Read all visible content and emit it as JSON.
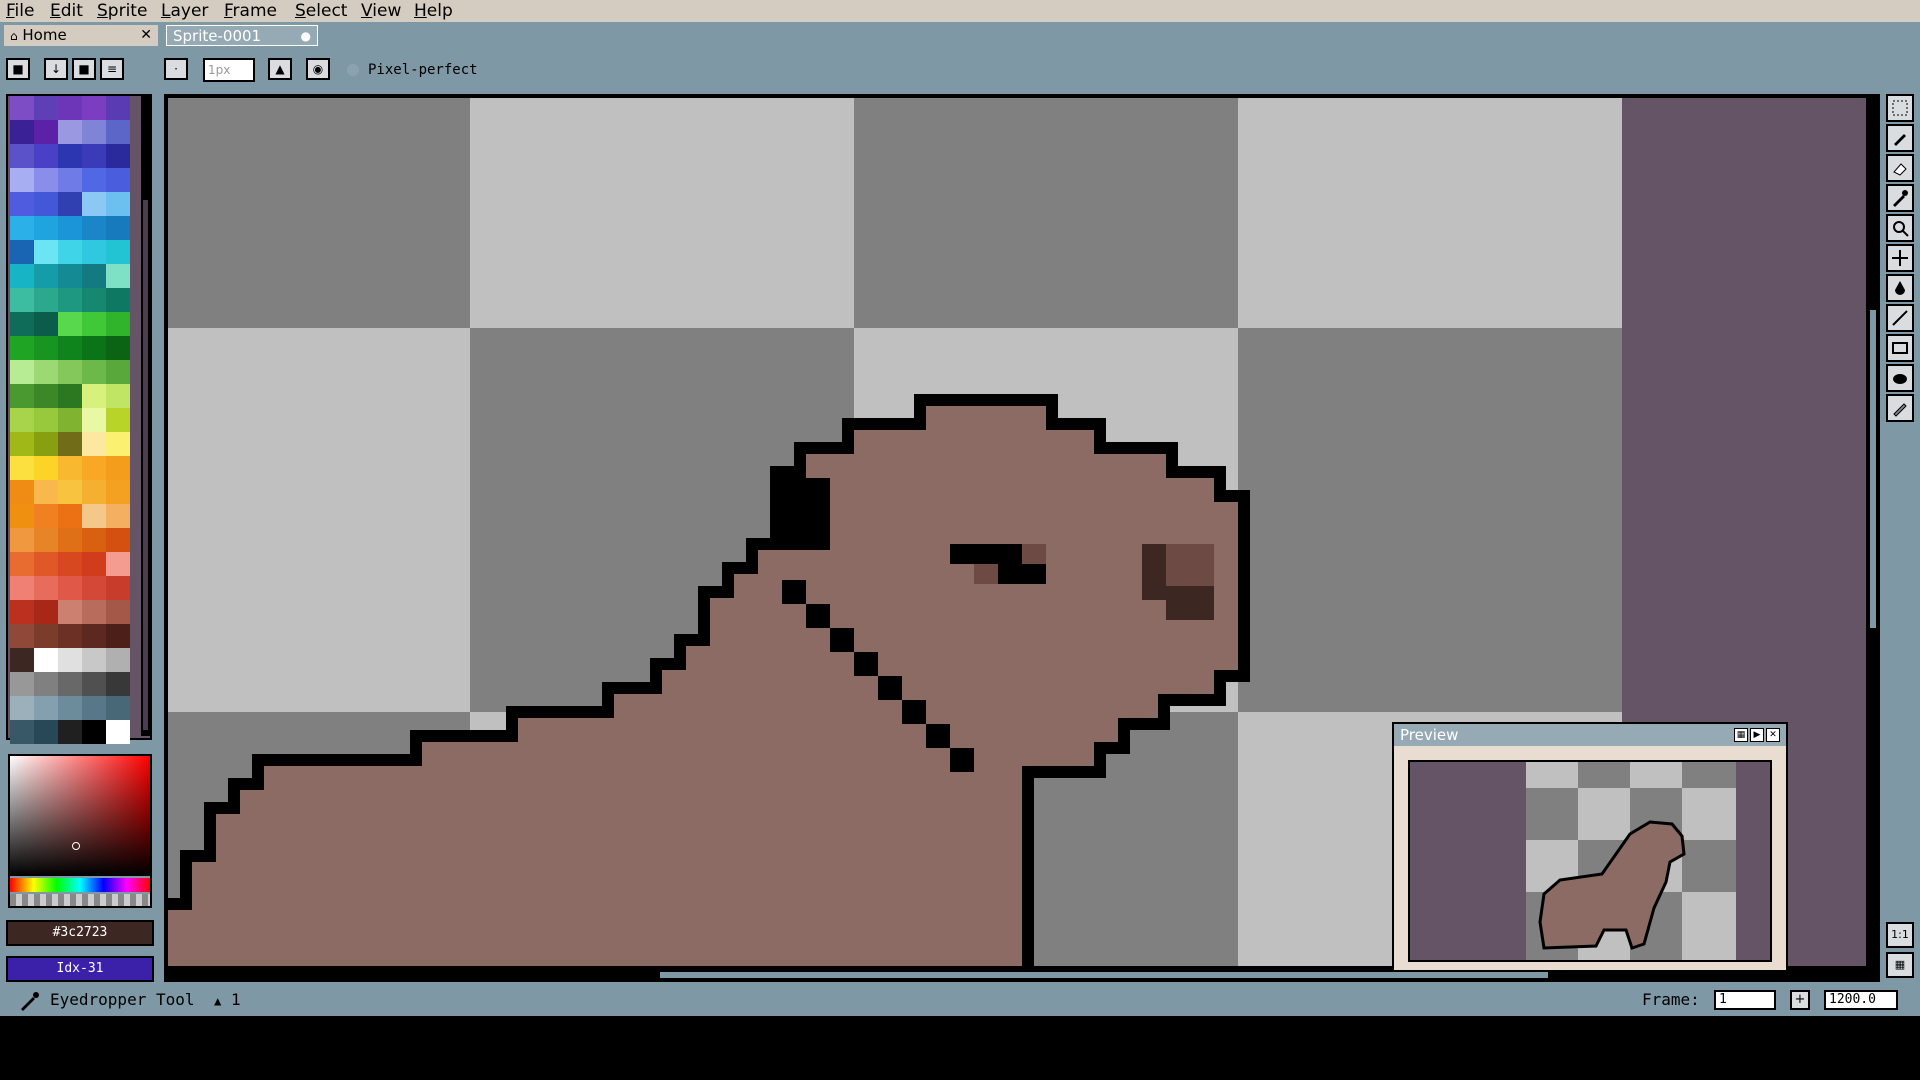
{
  "menu": {
    "items": [
      "File",
      "Edit",
      "Sprite",
      "Layer",
      "Frame",
      "Select",
      "View",
      "Help"
    ]
  },
  "tabs": {
    "home": "Home",
    "sprite": "Sprite-0001"
  },
  "context_bar": {
    "brush_size_placeholder": "1px",
    "pixel_perfect_label": "Pixel-perfect"
  },
  "color": {
    "foreground_hex": "#3c2723",
    "background_index": "Idx-31"
  },
  "preview": {
    "title": "Preview"
  },
  "status": {
    "tool_name": "Eyedropper Tool",
    "layer_indicator": "1",
    "frame_label": "Frame:",
    "frame_value": "1",
    "zoom_value": "1200.0"
  },
  "side_buttons": {
    "one_to_one": "1:1"
  },
  "palette_colors": [
    "#7d4dc5",
    "#5e3fb5",
    "#6d36b8",
    "#7d3dc0",
    "#5b3bb3",
    "#3a2296",
    "#5b22a8",
    "#9a98e0",
    "#7f84d6",
    "#5c66c9",
    "#5b52c9",
    "#4a40c5",
    "#2b36b0",
    "#3b3ab8",
    "#2a2a9c",
    "#a8aef2",
    "#8a8eea",
    "#6f7be6",
    "#5168e4",
    "#4a5ddc",
    "#4f5ce0",
    "#4258d8",
    "#3040b0",
    "#8cc8f4",
    "#6cc0f0",
    "#2cb0e8",
    "#20a4e0",
    "#1c94d8",
    "#1a86c8",
    "#167abc",
    "#1a64b4",
    "#6ce4f4",
    "#40d4e8",
    "#30c8e0",
    "#22c4d4",
    "#16b4c4",
    "#149ca8",
    "#148a94",
    "#127a80",
    "#7ee0c4",
    "#3cbca0",
    "#2ca88c",
    "#1e9880",
    "#168870",
    "#0e7862",
    "#0e6c58",
    "#0c5c4c",
    "#58d84c",
    "#40c838",
    "#30b42c",
    "#20a424",
    "#189420",
    "#10841c",
    "#0c7418",
    "#0a6414",
    "#b8ec94",
    "#9cd874",
    "#84c85c",
    "#6cb848",
    "#58a83c",
    "#4a9830",
    "#3c8828",
    "#2c7820",
    "#d8f07c",
    "#c0e464",
    "#a8d44c",
    "#98c83c",
    "#80b430",
    "#e8f8a4",
    "#b8d428",
    "#a0b818",
    "#88a010",
    "#706c18",
    "#fce8a0",
    "#fcf070",
    "#fce040",
    "#fcd428",
    "#f8b830",
    "#f8a824",
    "#f49c1c",
    "#f08c14",
    "#f8b84c",
    "#f8c440",
    "#f4b030",
    "#f4a020",
    "#f09010",
    "#f08020",
    "#ec7014",
    "#f4c888",
    "#f4b060",
    "#f09840",
    "#e88428",
    "#e07018",
    "#d86010",
    "#d45010",
    "#e86c30",
    "#e05828",
    "#d84820",
    "#d03c1c",
    "#f49c90",
    "#f08074",
    "#e86c5c",
    "#e05848",
    "#d44838",
    "#c83c2c",
    "#bc3020",
    "#a82818",
    "#cc8070",
    "#b86c5c",
    "#a45848",
    "#904838",
    "#7c3c2c",
    "#6c3024",
    "#5c2820",
    "#4c2018",
    "#3c2723",
    "#ffffff",
    "#e0e0e0",
    "#c8c8c8",
    "#b0b0b0",
    "#989898",
    "#808080",
    "#686868",
    "#505050",
    "#383838",
    "#9cb0bc",
    "#84a0ae",
    "#6c8c9c",
    "#58788a",
    "#486878",
    "#385868",
    "#284858",
    "#202020",
    "#000000",
    "#ffffff"
  ]
}
